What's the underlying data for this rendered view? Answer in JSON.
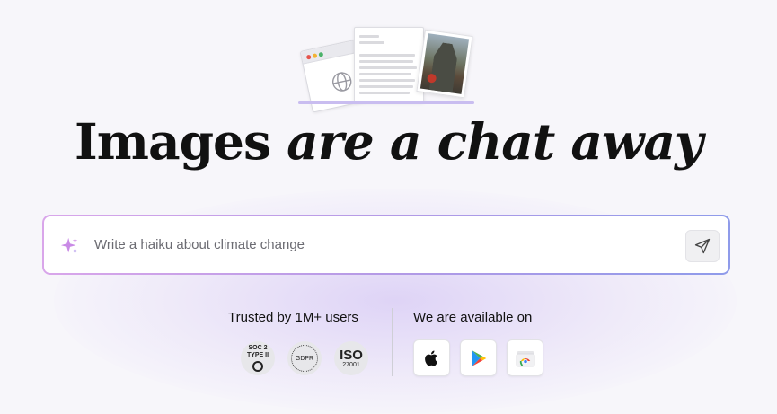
{
  "hero": {
    "title_bold": "Images",
    "title_italic": "are a chat away"
  },
  "prompt": {
    "placeholder": "Write a haiku about climate change",
    "value": "",
    "sparkle_icon": "sparkle-icon",
    "send_icon": "send-icon"
  },
  "trust": {
    "heading": "Trusted by 1M+ users",
    "badges": [
      {
        "name": "soc2-badge",
        "line1": "SOC 2",
        "line2": "TYPE II"
      },
      {
        "name": "gdpr-badge",
        "label": "GDPR"
      },
      {
        "name": "iso-badge",
        "big": "ISO",
        "small": "27001"
      }
    ]
  },
  "availability": {
    "heading": "We are available on",
    "stores": [
      {
        "name": "apple-app-store",
        "icon": "apple-icon"
      },
      {
        "name": "google-play-store",
        "icon": "google-play-icon"
      },
      {
        "name": "chrome-web-store",
        "icon": "chrome-icon"
      }
    ]
  },
  "colors": {
    "background": "#f7f6fa",
    "border_gradient_start": "#d9a6ea",
    "border_gradient_end": "#8f9bea",
    "sparkle": "#c07fe0",
    "text": "#111111"
  }
}
